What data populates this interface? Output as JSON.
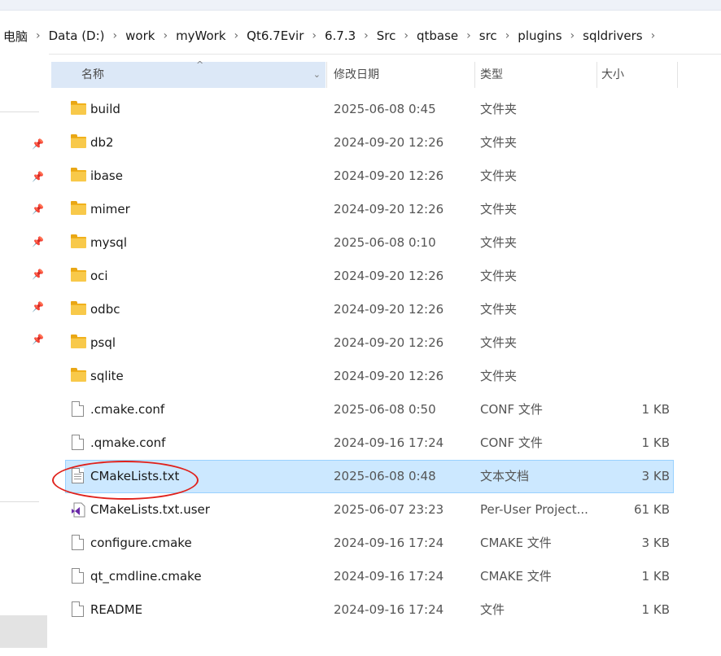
{
  "breadcrumb": [
    "电脑",
    "Data (D:)",
    "work",
    "myWork",
    "Qt6.7Evir",
    "6.7.3",
    "Src",
    "qtbase",
    "src",
    "plugins",
    "sqldrivers"
  ],
  "columns": {
    "name": "名称",
    "date": "修改日期",
    "type": "类型",
    "size": "大小"
  },
  "files": [
    {
      "name": "build",
      "date": "2025-06-08 0:45",
      "type": "文件夹",
      "size": "",
      "icon": "folder-icon"
    },
    {
      "name": "db2",
      "date": "2024-09-20 12:26",
      "type": "文件夹",
      "size": "",
      "icon": "folder-icon"
    },
    {
      "name": "ibase",
      "date": "2024-09-20 12:26",
      "type": "文件夹",
      "size": "",
      "icon": "folder-icon"
    },
    {
      "name": "mimer",
      "date": "2024-09-20 12:26",
      "type": "文件夹",
      "size": "",
      "icon": "folder-icon"
    },
    {
      "name": "mysql",
      "date": "2025-06-08 0:10",
      "type": "文件夹",
      "size": "",
      "icon": "folder-icon"
    },
    {
      "name": "oci",
      "date": "2024-09-20 12:26",
      "type": "文件夹",
      "size": "",
      "icon": "folder-icon"
    },
    {
      "name": "odbc",
      "date": "2024-09-20 12:26",
      "type": "文件夹",
      "size": "",
      "icon": "folder-icon"
    },
    {
      "name": "psql",
      "date": "2024-09-20 12:26",
      "type": "文件夹",
      "size": "",
      "icon": "folder-icon"
    },
    {
      "name": "sqlite",
      "date": "2024-09-20 12:26",
      "type": "文件夹",
      "size": "",
      "icon": "folder-icon"
    },
    {
      "name": ".cmake.conf",
      "date": "2025-06-08 0:50",
      "type": "CONF 文件",
      "size": "1 KB",
      "icon": "file-icon"
    },
    {
      "name": ".qmake.conf",
      "date": "2024-09-16 17:24",
      "type": "CONF 文件",
      "size": "1 KB",
      "icon": "file-icon"
    },
    {
      "name": "CMakeLists.txt",
      "date": "2025-06-08 0:48",
      "type": "文本文档",
      "size": "3 KB",
      "icon": "text-file-icon",
      "selected": true
    },
    {
      "name": "CMakeLists.txt.user",
      "date": "2025-06-07 23:23",
      "type": "Per-User Project...",
      "size": "61 KB",
      "icon": "visual-studio-icon"
    },
    {
      "name": "configure.cmake",
      "date": "2024-09-16 17:24",
      "type": "CMAKE 文件",
      "size": "3 KB",
      "icon": "file-icon"
    },
    {
      "name": "qt_cmdline.cmake",
      "date": "2024-09-16 17:24",
      "type": "CMAKE 文件",
      "size": "1 KB",
      "icon": "file-icon"
    },
    {
      "name": "README",
      "date": "2024-09-16 17:24",
      "type": "文件",
      "size": "1 KB",
      "icon": "file-icon"
    }
  ],
  "sidebar": {
    "pinned_count": 7,
    "pin_icon": "pin-icon"
  },
  "colors": {
    "selection": "#cce8ff",
    "header_highlight": "#dce8f7",
    "folder": "#f8c94a",
    "annotation": "#e0221c"
  }
}
